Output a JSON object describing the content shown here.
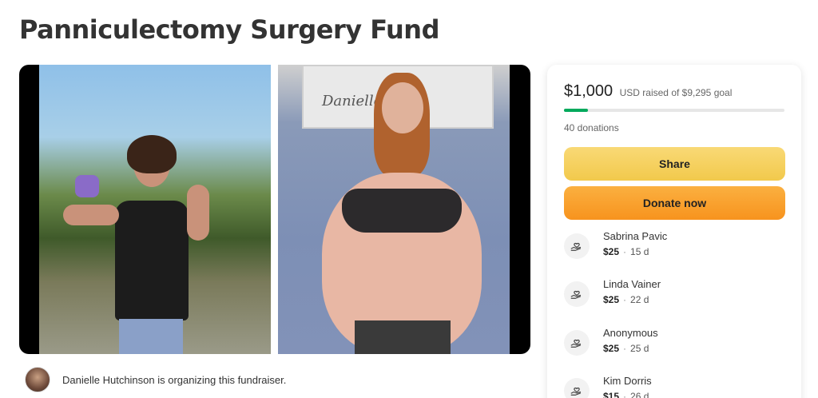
{
  "title": "Panniculectomy Surgery Fund",
  "media": {
    "sign_text": "Danielle Ryan"
  },
  "summary": {
    "amount": "$1,000",
    "currency_text": "USD raised of $9,295 goal",
    "progress_fraction": 0.108,
    "donations": "40 donations"
  },
  "buttons": {
    "share": "Share",
    "donate": "Donate now"
  },
  "donors": [
    {
      "name": "Sabrina Pavic",
      "amount": "$25",
      "time": "15 d"
    },
    {
      "name": "Linda Vainer",
      "amount": "$25",
      "time": "22 d"
    },
    {
      "name": "Anonymous",
      "amount": "$25",
      "time": "25 d"
    },
    {
      "name": "Kim Dorris",
      "amount": "$15",
      "time": "26 d"
    }
  ],
  "organizer": {
    "text": "Danielle Hutchinson is organizing this fundraiser."
  },
  "colors": {
    "progress": "#02a95c",
    "share_button": "#f2c94c",
    "donate_button": "#f7931e"
  },
  "icons": {
    "donor": "heart-hand-icon"
  }
}
